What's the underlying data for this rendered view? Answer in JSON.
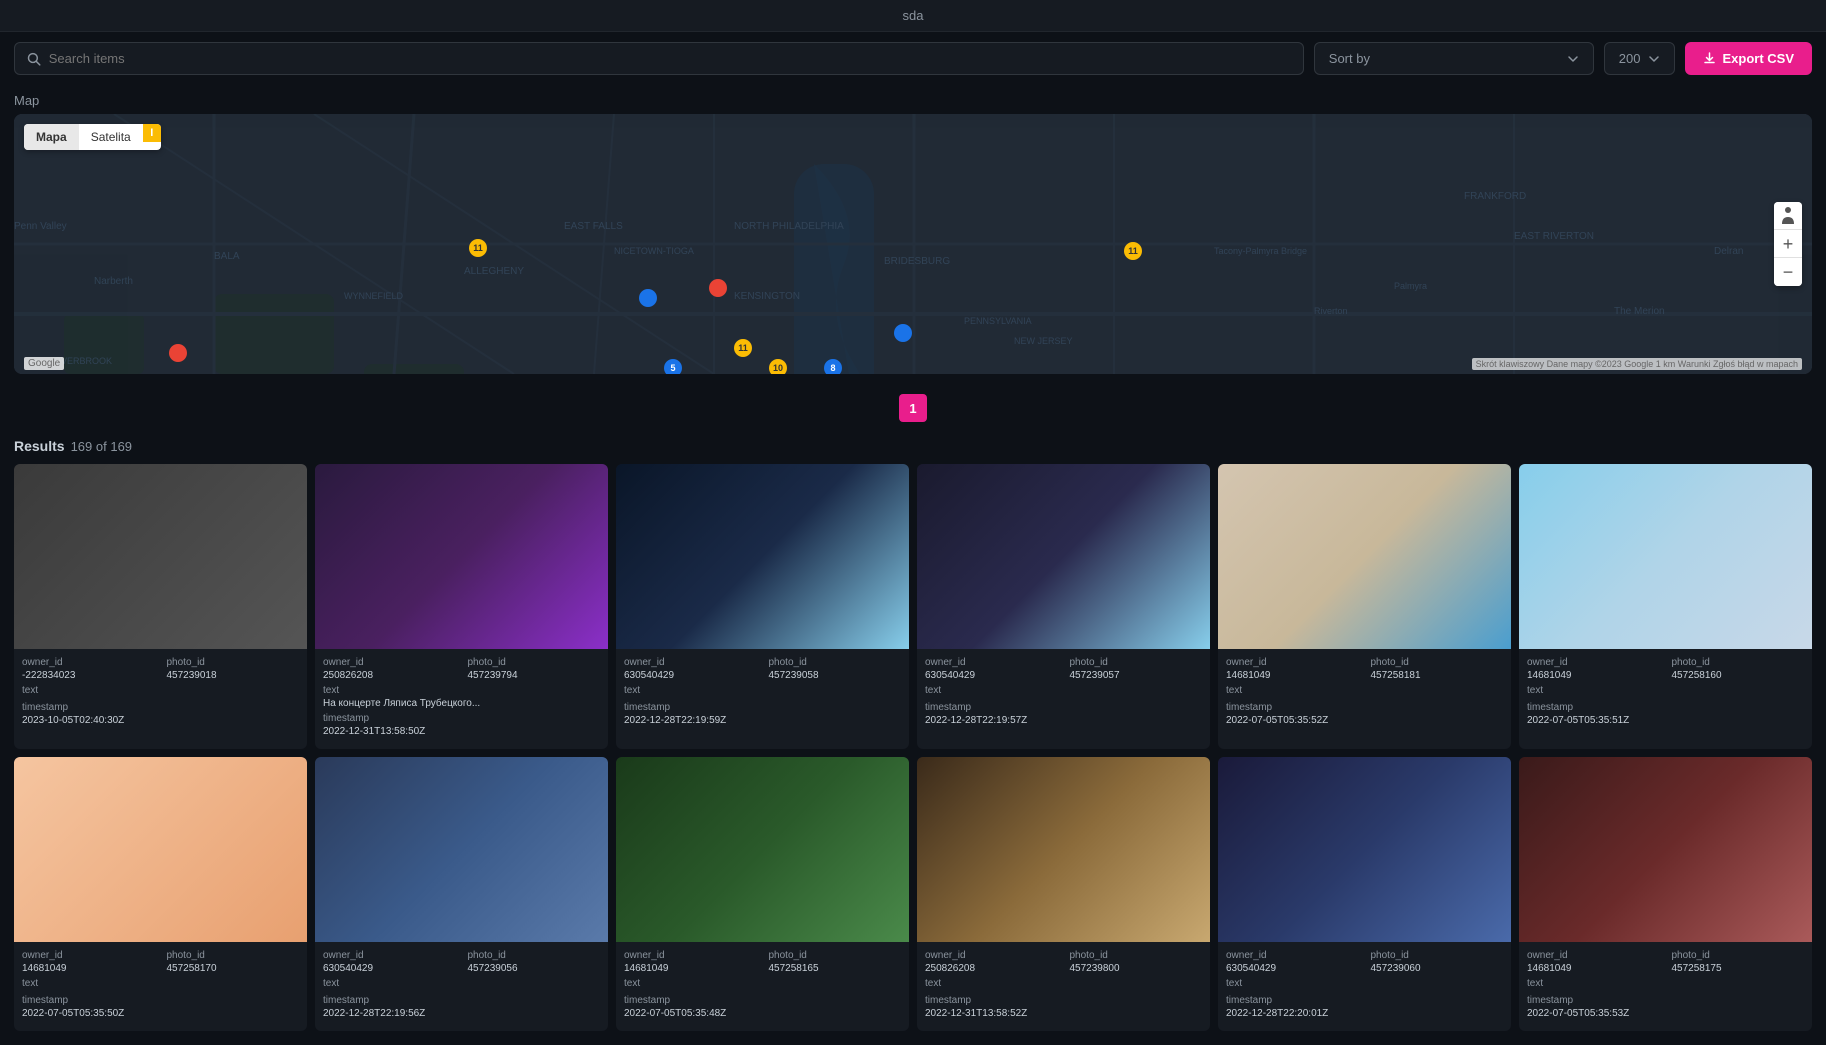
{
  "titleBar": {
    "title": "sda"
  },
  "toolbar": {
    "searchPlaceholder": "Search items",
    "sortLabel": "Sort by",
    "countValue": "200",
    "exportLabel": "Export CSV"
  },
  "map": {
    "label": "Map",
    "mapTypeButtons": [
      "Mapa",
      "Satelita"
    ],
    "activeMapType": "Mapa",
    "googleLabel": "Google",
    "attribution": "Skrót klawiszowy  Dane mapy ©2023 Google  1 km   Warunki  Zgłoś błąd w mapach",
    "zoomIn": "+",
    "zoomOut": "−"
  },
  "pagination": {
    "currentPage": "1"
  },
  "results": {
    "title": "Results",
    "count": "169 of 169"
  },
  "items": [
    {
      "photoClass": "photo-1",
      "owner_id": "-222834023",
      "photo_id": "457239018",
      "text": "",
      "timestamp": "2023-10-05T02:40:30Z"
    },
    {
      "photoClass": "photo-2",
      "owner_id": "250826208",
      "photo_id": "457239794",
      "text": "На концерте Ляписа Трубецкого...",
      "timestamp": "2022-12-31T13:58:50Z"
    },
    {
      "photoClass": "photo-3",
      "owner_id": "630540429",
      "photo_id": "457239058",
      "text": "",
      "timestamp": "2022-12-28T22:19:59Z"
    },
    {
      "photoClass": "photo-4",
      "owner_id": "630540429",
      "photo_id": "457239057",
      "text": "",
      "timestamp": "2022-12-28T22:19:57Z"
    },
    {
      "photoClass": "photo-5",
      "owner_id": "14681049",
      "photo_id": "457258181",
      "text": "",
      "timestamp": "2022-07-05T05:35:52Z"
    },
    {
      "photoClass": "photo-6",
      "owner_id": "14681049",
      "photo_id": "457258160",
      "text": "",
      "timestamp": "2022-07-05T05:35:51Z"
    },
    {
      "photoClass": "photo-7",
      "owner_id": "14681049",
      "photo_id": "457258170",
      "text": "",
      "timestamp": "2022-07-05T05:35:50Z"
    },
    {
      "photoClass": "photo-8",
      "owner_id": "630540429",
      "photo_id": "457239056",
      "text": "",
      "timestamp": "2022-12-28T22:19:56Z"
    },
    {
      "photoClass": "photo-9",
      "owner_id": "14681049",
      "photo_id": "457258165",
      "text": "",
      "timestamp": "2022-07-05T05:35:48Z"
    },
    {
      "photoClass": "photo-10",
      "owner_id": "250826208",
      "photo_id": "457239800",
      "text": "",
      "timestamp": "2022-12-31T13:58:52Z"
    },
    {
      "photoClass": "photo-11",
      "owner_id": "630540429",
      "photo_id": "457239060",
      "text": "",
      "timestamp": "2022-12-28T22:20:01Z"
    },
    {
      "photoClass": "photo-12",
      "owner_id": "14681049",
      "photo_id": "457258175",
      "text": "",
      "timestamp": "2022-07-05T05:35:53Z"
    }
  ],
  "labels": {
    "owner_id": "owner_id",
    "photo_id": "photo_id",
    "text": "text",
    "timestamp": "timestamp"
  },
  "colors": {
    "accent": "#e91e8c",
    "background": "#0d1117",
    "surface": "#161b22",
    "border": "#30363d",
    "textPrimary": "#c9d1d9",
    "textSecondary": "#8b949e"
  }
}
